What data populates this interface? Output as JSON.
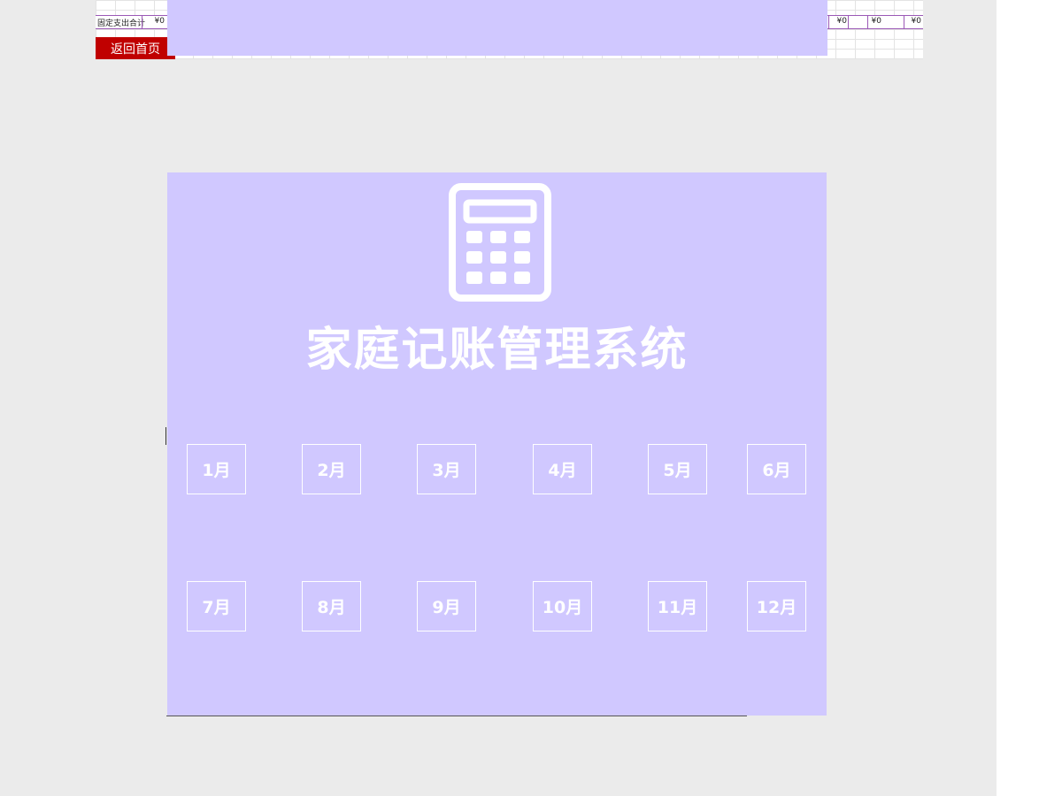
{
  "app": {
    "title": "家庭记账管理系统",
    "icon": "calculator-icon"
  },
  "spreadsheet": {
    "total_row_label": "固定支出合计",
    "total_values": [
      "¥0",
      "¥0",
      "¥0",
      "¥0"
    ],
    "return_home_label": "返回首页"
  },
  "months": [
    {
      "label": "1月"
    },
    {
      "label": "2月"
    },
    {
      "label": "3月"
    },
    {
      "label": "4月"
    },
    {
      "label": "5月"
    },
    {
      "label": "6月"
    },
    {
      "label": "7月"
    },
    {
      "label": "8月"
    },
    {
      "label": "9月"
    },
    {
      "label": "10月"
    },
    {
      "label": "11月"
    },
    {
      "label": "12月"
    }
  ],
  "colors": {
    "panel": "#d0c8ff",
    "return_button": "#c00000",
    "workspace": "#ebebeb",
    "row_border": "#9b59b6"
  }
}
